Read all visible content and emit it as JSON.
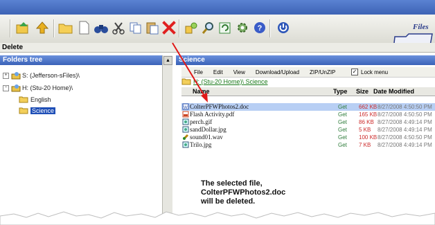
{
  "toolbar": {
    "statusline": "Delete",
    "logo_text": "Files",
    "buttons": [
      {
        "icon": "folder-up-icon"
      },
      {
        "icon": "up-arrow-icon"
      },
      {
        "icon": "new-folder-icon"
      },
      {
        "icon": "new-file-icon"
      },
      {
        "icon": "binoculars-icon"
      },
      {
        "icon": "cut-icon"
      },
      {
        "icon": "copy-icon"
      },
      {
        "icon": "paste-icon"
      },
      {
        "icon": "delete-icon"
      },
      {
        "icon": "properties-icon"
      },
      {
        "icon": "search-icon"
      },
      {
        "icon": "refresh-icon"
      },
      {
        "icon": "settings-icon"
      },
      {
        "icon": "help-icon"
      },
      {
        "icon": "power-icon"
      }
    ]
  },
  "folders_tree": {
    "title": "Folders tree",
    "items": [
      {
        "label": "S: (Jefferson-sFiles)\\",
        "expanded": false
      },
      {
        "label": "H: (Stu-20 Home)\\",
        "expanded": true
      },
      {
        "label": "English"
      },
      {
        "label": "Science",
        "selected": true
      }
    ]
  },
  "file_list": {
    "title": "Science",
    "menu": [
      "File",
      "Edit",
      "View",
      "Download/Upload",
      "ZIP/UnZIP"
    ],
    "lock_menu": "Lock menu",
    "path": "H: (Stu-20 Home)\\ Science",
    "columns": [
      "Name",
      "Type",
      "Size",
      "Date Modified"
    ],
    "rows": [
      {
        "name": "ColterPFWPhotos2.doc",
        "type": "Get",
        "size": "662 KB",
        "date": "8/27/2008 4:50:50 PM",
        "selected": true
      },
      {
        "name": "Flash Activity.pdf",
        "type": "Get",
        "size": "165 KB",
        "date": "8/27/2008 4:50:50 PM"
      },
      {
        "name": "perch.gif",
        "type": "Get",
        "size": "86 KB",
        "date": "8/27/2008 4:49:14 PM"
      },
      {
        "name": "sandDollar.jpg",
        "type": "Get",
        "size": "5 KB",
        "date": "8/27/2008 4:49:14 PM"
      },
      {
        "name": "sound01.wav",
        "type": "Get",
        "size": "100 KB",
        "date": "8/27/2008 4:50:50 PM"
      },
      {
        "name": "Trilo.jpg",
        "type": "Get",
        "size": "7 KB",
        "date": "8/27/2008 4:49:14 PM"
      }
    ]
  },
  "annotation": {
    "line1": "The selected file,",
    "line2": "ColterPFWPhotos2.doc",
    "line3": "will be deleted."
  },
  "colors": {
    "accent": "#3a62b8",
    "delete_red": "#e02020",
    "selection": "#b8cff4"
  }
}
